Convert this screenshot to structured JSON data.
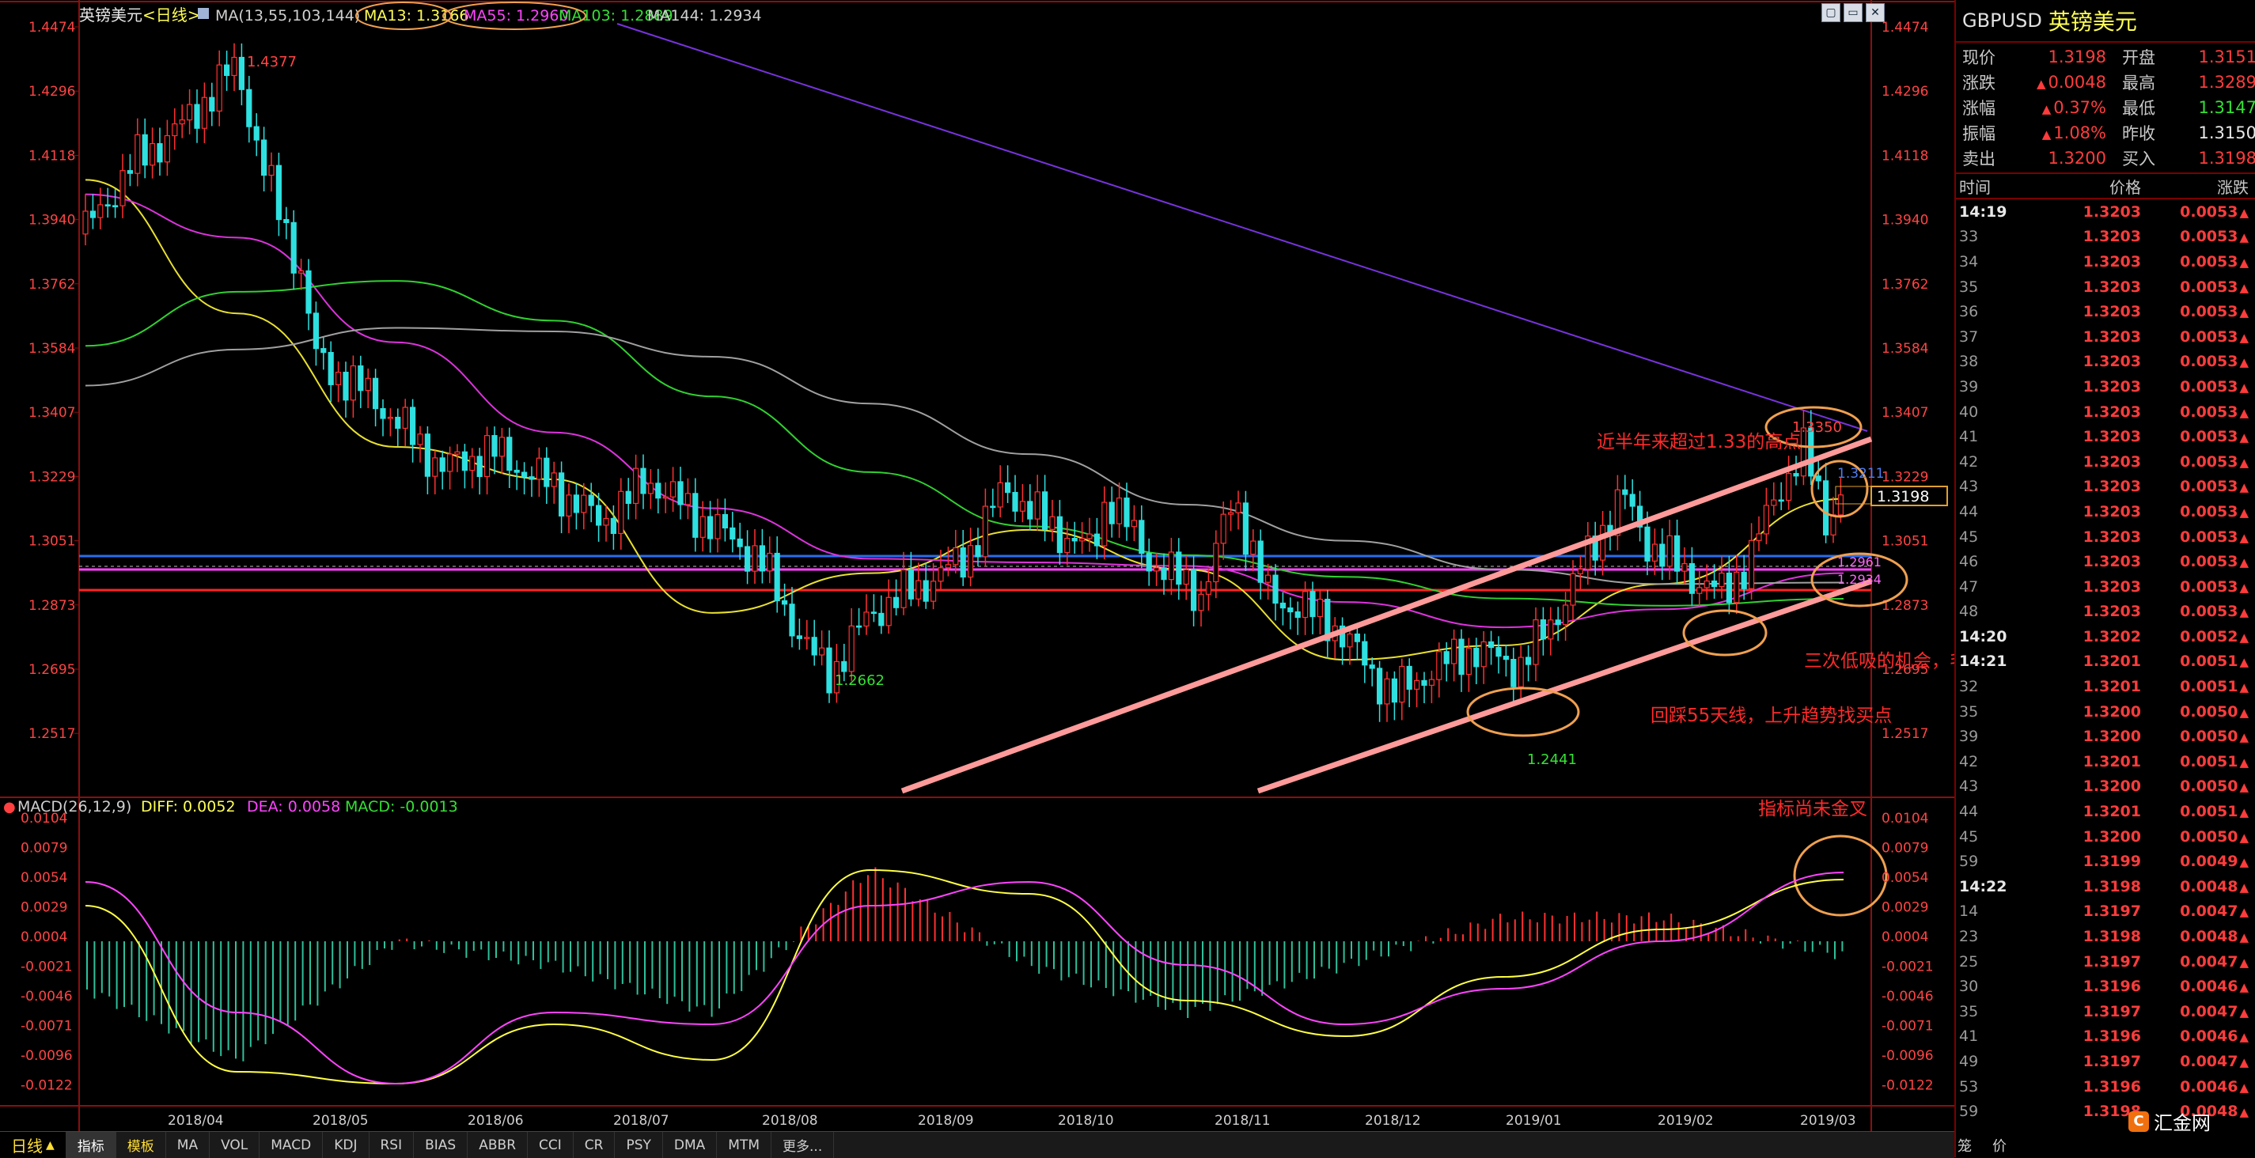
{
  "chart_header": {
    "name": "英镑美元",
    "period": "<日线>",
    "ma_label": "MA(13,55,103,144)",
    "ma13": "MA13: 1.3166",
    "ma55": "MA55: 1.2960",
    "ma103": "MA103: 1.2889",
    "ma144": "MA144: 1.2934"
  },
  "price_axis": [
    "1.4474",
    "1.4296",
    "1.4118",
    "1.3940",
    "1.3762",
    "1.3584",
    "1.3407",
    "1.3229",
    "1.3051",
    "1.2873",
    "1.2695",
    "1.2517"
  ],
  "macd_header": {
    "label": "MACD(26,12,9)",
    "diff": "DIFF: 0.0052",
    "dea": "DEA: 0.0058",
    "macd": "MACD: -0.0013"
  },
  "macd_axis": [
    "0.0104",
    "0.0079",
    "0.0054",
    "0.0029",
    "0.0004",
    "-0.0021",
    "-0.0046",
    "-0.0071",
    "-0.0096",
    "-0.0122"
  ],
  "date_axis": [
    "2018/04",
    "2018/05",
    "2018/06",
    "2018/07",
    "2018/08",
    "2018/09",
    "2018/10",
    "2018/11",
    "2018/12",
    "2019/01",
    "2019/02",
    "2019/03"
  ],
  "price_labels": {
    "high": "1.4377",
    "low1": "1.2662",
    "low2": "1.2441",
    "recent_high": "1.3350",
    "current": "1.3198",
    "right_1_3229": "1.3229",
    "right_1_2873": "1.2873",
    "ma_tag_1": "1.3211",
    "ma_tag_2": "1.2961",
    "ma_tag_3": "1.2934"
  },
  "annotations": {
    "note1": "近半年来超过1.33的高点",
    "note2": "三次低吸的机会，毛均都提示过了",
    "note3": "回踩55天线，上升趋势找买点",
    "note4": "指标尚未金叉"
  },
  "tabs": {
    "period_tab": "日线",
    "items": [
      "指标",
      "模板",
      "MA",
      "VOL",
      "MACD",
      "KDJ",
      "RSI",
      "BIAS",
      "ABBR",
      "CCI",
      "CR",
      "PSY",
      "DMA",
      "MTM",
      "更多..."
    ]
  },
  "quote": {
    "code": "GBPUSD",
    "name": "英镑美元",
    "rows": [
      {
        "l1": "现价",
        "v1": "1.3198",
        "l2": "开盘",
        "v2": "1.3151"
      },
      {
        "l1": "涨跌",
        "v1": "0.0048",
        "l2": "最高",
        "v2": "1.3289"
      },
      {
        "l1": "涨幅",
        "v1": "0.37%",
        "l2": "最低",
        "v2": "1.3147"
      },
      {
        "l1": "振幅",
        "v1": "1.08%",
        "l2": "昨收",
        "v2": "1.3150"
      },
      {
        "l1": "卖出",
        "v1": "1.3200",
        "l2": "买入",
        "v2": "1.3198"
      }
    ],
    "table_headers": [
      "时间",
      "价格",
      "涨跌"
    ],
    "ticks": [
      {
        "t": "14:19",
        "p": "1.3203",
        "c": "0.0053",
        "major": true
      },
      {
        "t": "33",
        "p": "1.3203",
        "c": "0.0053"
      },
      {
        "t": "34",
        "p": "1.3203",
        "c": "0.0053"
      },
      {
        "t": "35",
        "p": "1.3203",
        "c": "0.0053"
      },
      {
        "t": "36",
        "p": "1.3203",
        "c": "0.0053"
      },
      {
        "t": "37",
        "p": "1.3203",
        "c": "0.0053"
      },
      {
        "t": "38",
        "p": "1.3203",
        "c": "0.0053"
      },
      {
        "t": "39",
        "p": "1.3203",
        "c": "0.0053"
      },
      {
        "t": "40",
        "p": "1.3203",
        "c": "0.0053"
      },
      {
        "t": "41",
        "p": "1.3203",
        "c": "0.0053"
      },
      {
        "t": "42",
        "p": "1.3203",
        "c": "0.0053"
      },
      {
        "t": "43",
        "p": "1.3203",
        "c": "0.0053"
      },
      {
        "t": "44",
        "p": "1.3203",
        "c": "0.0053"
      },
      {
        "t": "45",
        "p": "1.3203",
        "c": "0.0053"
      },
      {
        "t": "46",
        "p": "1.3203",
        "c": "0.0053"
      },
      {
        "t": "47",
        "p": "1.3203",
        "c": "0.0053"
      },
      {
        "t": "48",
        "p": "1.3203",
        "c": "0.0053"
      },
      {
        "t": "14:20",
        "p": "1.3202",
        "c": "0.0052",
        "major": true
      },
      {
        "t": "14:21",
        "p": "1.3201",
        "c": "0.0051",
        "major": true
      },
      {
        "t": "32",
        "p": "1.3201",
        "c": "0.0051"
      },
      {
        "t": "35",
        "p": "1.3200",
        "c": "0.0050"
      },
      {
        "t": "39",
        "p": "1.3200",
        "c": "0.0050"
      },
      {
        "t": "42",
        "p": "1.3201",
        "c": "0.0051"
      },
      {
        "t": "43",
        "p": "1.3200",
        "c": "0.0050"
      },
      {
        "t": "44",
        "p": "1.3201",
        "c": "0.0051"
      },
      {
        "t": "45",
        "p": "1.3200",
        "c": "0.0050"
      },
      {
        "t": "59",
        "p": "1.3199",
        "c": "0.0049"
      },
      {
        "t": "14:22",
        "p": "1.3198",
        "c": "0.0048",
        "major": true
      },
      {
        "t": "14",
        "p": "1.3197",
        "c": "0.0047"
      },
      {
        "t": "23",
        "p": "1.3198",
        "c": "0.0048"
      },
      {
        "t": "25",
        "p": "1.3197",
        "c": "0.0047"
      },
      {
        "t": "30",
        "p": "1.3196",
        "c": "0.0046"
      },
      {
        "t": "35",
        "p": "1.3197",
        "c": "0.0047"
      },
      {
        "t": "41",
        "p": "1.3196",
        "c": "0.0046"
      },
      {
        "t": "49",
        "p": "1.3197",
        "c": "0.0047"
      },
      {
        "t": "53",
        "p": "1.3196",
        "c": "0.0046"
      },
      {
        "t": "59",
        "p": "1.3198",
        "c": "0.0048"
      }
    ],
    "footer_left": "笼",
    "footer_right": "价"
  },
  "watermark": "汇金网",
  "chart_data": {
    "type": "line",
    "title": "英镑美元<日线>",
    "x": [
      "2018/04",
      "2018/05",
      "2018/06",
      "2018/07",
      "2018/08",
      "2018/09",
      "2018/10",
      "2018/11",
      "2018/12",
      "2019/01",
      "2019/02",
      "2019/03"
    ],
    "ylim": [
      1.244,
      1.4474
    ],
    "series": [
      {
        "name": "MA13",
        "values": [
          1.405,
          1.368,
          1.331,
          1.322,
          1.285,
          1.296,
          1.308,
          1.297,
          1.272,
          1.276,
          1.293,
          1.3166
        ]
      },
      {
        "name": "MA55",
        "values": [
          1.401,
          1.389,
          1.36,
          1.335,
          1.314,
          1.3,
          1.299,
          1.298,
          1.288,
          1.281,
          1.286,
          1.296
        ]
      },
      {
        "name": "MA103",
        "values": [
          1.359,
          1.374,
          1.377,
          1.366,
          1.345,
          1.324,
          1.309,
          1.301,
          1.295,
          1.289,
          1.287,
          1.2889
        ]
      },
      {
        "name": "MA144",
        "values": [
          1.348,
          1.358,
          1.364,
          1.363,
          1.356,
          1.343,
          1.329,
          1.315,
          1.305,
          1.297,
          1.293,
          1.2934
        ]
      }
    ],
    "key_levels": {
      "blue_line": 1.3229,
      "magenta_line": 1.296,
      "red_line": 1.2905,
      "high": 1.4377,
      "low1": 1.2662,
      "low2": 1.2441,
      "recent_high": 1.335,
      "last": 1.3198
    },
    "macd": {
      "diff": [
        0.003,
        -0.011,
        -0.012,
        -0.007,
        -0.01,
        0.006,
        0.004,
        -0.005,
        -0.008,
        -0.003,
        0.001,
        0.0052
      ],
      "dea": [
        0.005,
        -0.006,
        -0.012,
        -0.006,
        -0.007,
        0.003,
        0.005,
        -0.002,
        -0.007,
        -0.004,
        0.0,
        0.0058
      ],
      "ylim": [
        -0.0122,
        0.0104
      ]
    }
  }
}
